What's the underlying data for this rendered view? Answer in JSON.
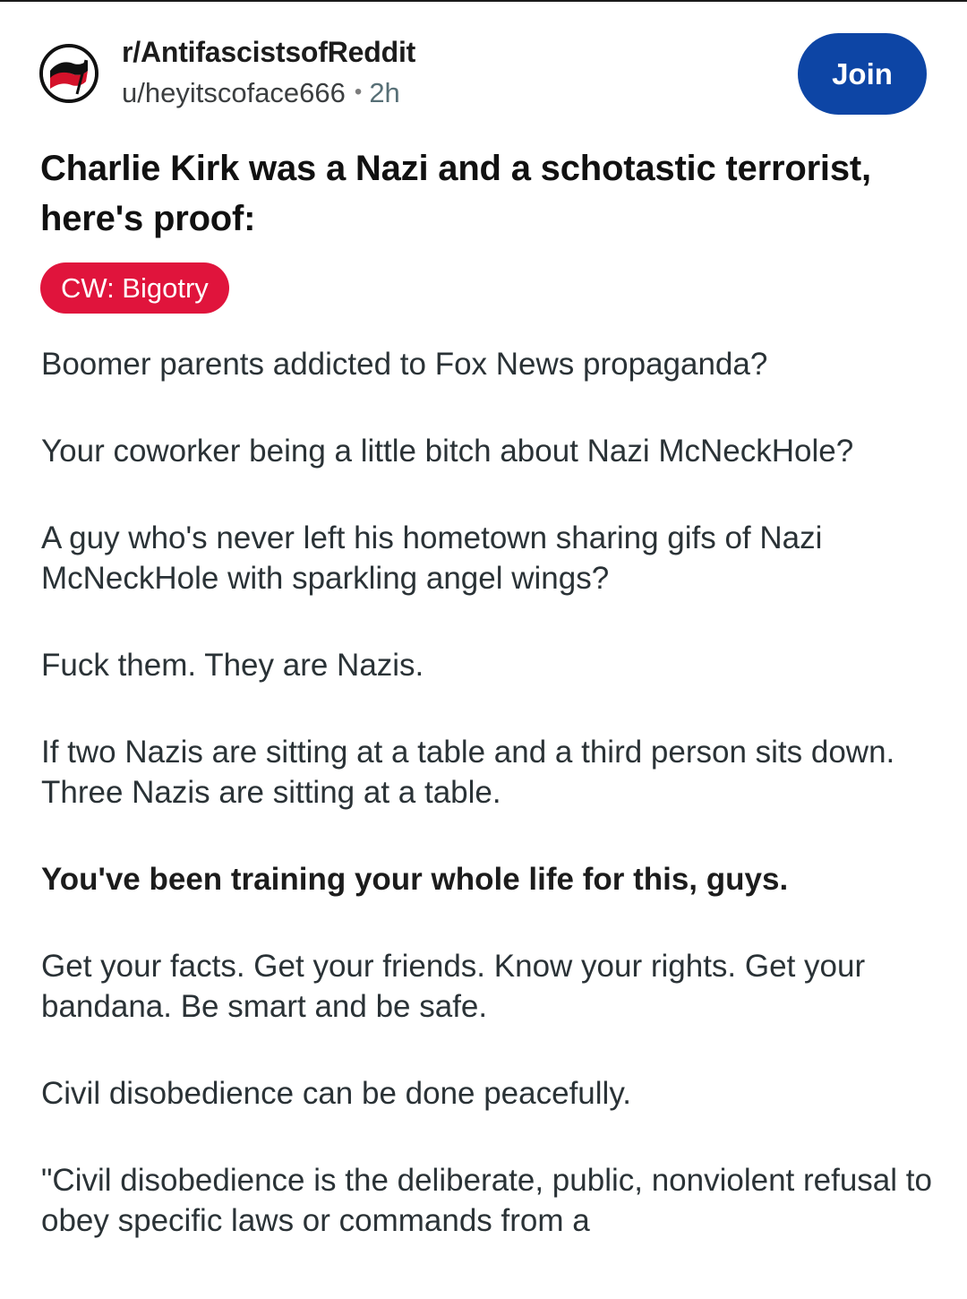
{
  "post": {
    "subreddit": "r/AntifascistsofReddit",
    "author": "u/heyitscoface666",
    "separator": "•",
    "time": "2h",
    "join_label": "Join",
    "title": "Charlie Kirk was a Nazi and a schotastic terrorist, here's proof:",
    "flair": "CW: Bigotry",
    "flair_color": "#e0143c",
    "join_color": "#0d45a5",
    "avatar_icon": "antifa-flag-icon",
    "paragraphs": {
      "p1": "Boomer parents addicted to Fox News propaganda?",
      "p2": "Your coworker being a little bitch about Nazi McNeckHole?",
      "p3": "A guy who's never left his hometown sharing gifs of Nazi McNeckHole with sparkling angel wings?",
      "p4": "Fuck them. They are Nazis.",
      "p5": "If two Nazis are sitting at a table and a third person sits down. Three Nazis are sitting at a table.",
      "p6": "You've been training your whole life for this, guys.",
      "p7": "Get your facts. Get your friends. Know your rights. Get your bandana. Be smart and be safe.",
      "p8": "Civil disobedience can be done peacefully.",
      "p9": "\"Civil disobedience is the deliberate, public, nonviolent refusal to obey specific laws or commands from a"
    }
  }
}
